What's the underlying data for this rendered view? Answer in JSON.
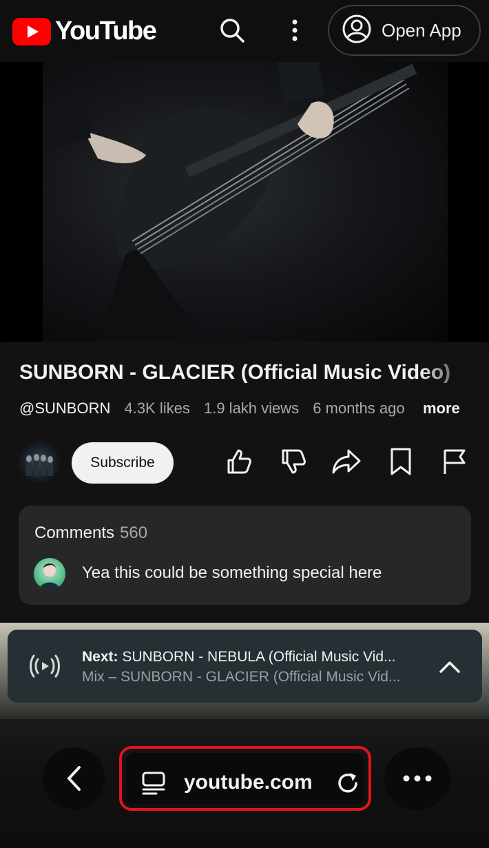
{
  "header": {
    "brand": "YouTube",
    "icons": [
      "search-icon",
      "more-vert-icon",
      "account-icon"
    ],
    "open_app_label": "Open App"
  },
  "video": {
    "title": "SUNBORN - GLACIER (Official Music Video)",
    "channel": "@SUNBORN",
    "likes": "4.3K likes",
    "views": "1.9 lakh views",
    "age": "6 months ago",
    "more_label": "more",
    "subscribe_label": "Subscribe",
    "actions": [
      "like-icon",
      "dislike-icon",
      "share-icon",
      "save-icon",
      "report-flag-icon"
    ]
  },
  "comments": {
    "label": "Comments",
    "count": "560",
    "preview": "Yea this could be something special here"
  },
  "next_up": {
    "prefix": "Next:",
    "title": "SUNBORN - NEBULA (Official Music Vid...",
    "playlist": "Mix – SUNBORN - GLACIER (Official Music Vid..."
  },
  "browser": {
    "url": "youtube.com",
    "highlight_color": "#e0161c"
  },
  "colors": {
    "brand_red": "#ff0000",
    "background": "#0f0f0f",
    "card": "#272727"
  }
}
